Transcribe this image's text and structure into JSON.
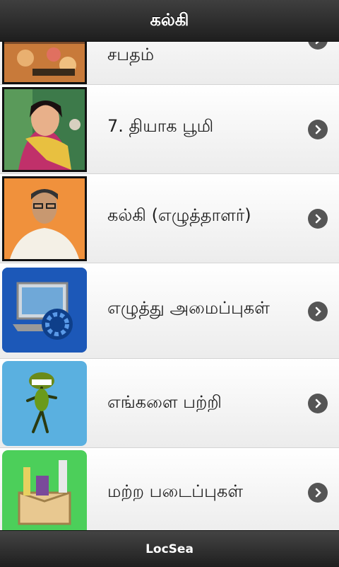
{
  "header": {
    "title": "கல்கி"
  },
  "list": {
    "items": [
      {
        "label": "சபதம்",
        "thumb": "painting-crowd-thumbnail"
      },
      {
        "label": "7. தியாக பூமி",
        "thumb": "painting-woman-thumbnail"
      },
      {
        "label": "கல்கி (எழுத்தாளர்)",
        "thumb": "author-portrait-thumbnail"
      },
      {
        "label": "எழுத்து அமைப்புகள்",
        "thumb": "settings-computer-thumbnail"
      },
      {
        "label": "எங்களை பற்றி",
        "thumb": "about-figure-thumbnail"
      },
      {
        "label": "மற்ற படைப்புகள்",
        "thumb": "other-works-box-thumbnail"
      }
    ]
  },
  "footer": {
    "label": "LocSea"
  },
  "colors": {
    "header_bg": "#2b2b2b",
    "chevron_bg": "#555555",
    "row_bg": "#f4f4f4"
  }
}
